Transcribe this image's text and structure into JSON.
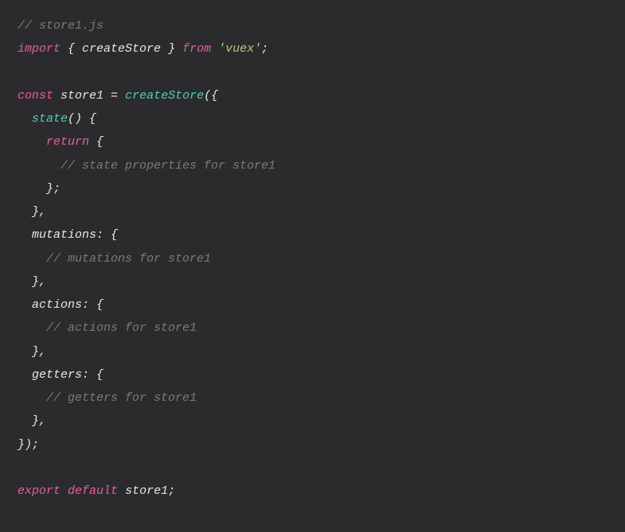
{
  "code": {
    "l1_comment": "// store1.js",
    "l2_import": "import",
    "l2_brace_open": " { ",
    "l2_createStore": "createStore",
    "l2_brace_close": " } ",
    "l2_from": "from",
    "l2_space": " ",
    "l2_string": "'vuex'",
    "l2_semi": ";",
    "l4_const": "const",
    "l4_space1": " ",
    "l4_store1": "store1",
    "l4_eq": " = ",
    "l4_createStore": "createStore",
    "l4_paren_brace": "({",
    "l5_indent": "  ",
    "l5_state": "state",
    "l5_parens": "()",
    "l5_brace": " {",
    "l6_indent": "    ",
    "l6_return": "return",
    "l6_brace": " {",
    "l7_indent": "      ",
    "l7_comment": "// state properties for store1",
    "l8_indent": "    ",
    "l8_close": "};",
    "l9_indent": "  ",
    "l9_close": "},",
    "l10_indent": "  ",
    "l10_mutations": "mutations",
    "l10_colon_brace": ": {",
    "l11_indent": "    ",
    "l11_comment": "// mutations for store1",
    "l12_indent": "  ",
    "l12_close": "},",
    "l13_indent": "  ",
    "l13_actions": "actions",
    "l13_colon_brace": ": {",
    "l14_indent": "    ",
    "l14_comment": "// actions for store1",
    "l15_indent": "  ",
    "l15_close": "},",
    "l16_indent": "  ",
    "l16_getters": "getters",
    "l16_colon_brace": ": {",
    "l17_indent": "    ",
    "l17_comment": "// getters for store1",
    "l18_indent": "  ",
    "l18_close": "},",
    "l19_close": "});",
    "l21_export": "export",
    "l21_space1": " ",
    "l21_default": "default",
    "l21_space2": " ",
    "l21_store1": "store1",
    "l21_semi": ";"
  }
}
